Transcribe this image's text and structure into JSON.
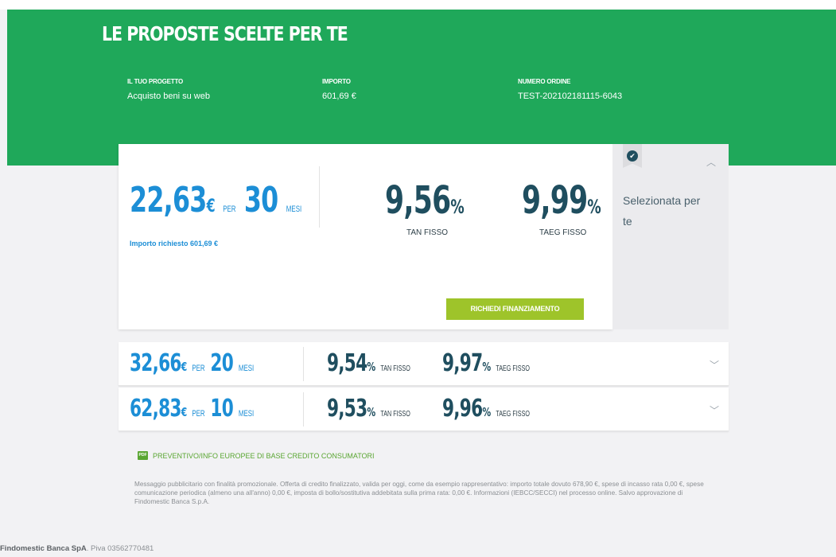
{
  "hero": {
    "title": "LE PROPOSTE SCELTE PER TE",
    "project_label": "IL TUO PROGETTO",
    "project_value": "Acquisto beni su web",
    "amount_label": "IMPORTO",
    "amount_value": "601,69 €",
    "order_label": "NUMERO ORDINE",
    "order_value": "TEST-202102181115-6043"
  },
  "selected_offer": {
    "installment": "22,63",
    "currency": "€",
    "per": "PER",
    "months": "30",
    "months_label": "MESI",
    "requested_amount": "Importo richiesto 601,69 €",
    "tan": "9,56",
    "tan_label": "TAN FISSO",
    "taeg": "9,99",
    "taeg_label": "TAEG FISSO",
    "percent": "%",
    "cta_label": "RICHIEDI FINANZIAMENTO",
    "selected_text": "Selezionata per te",
    "check_icon": "✔",
    "collapse_icon": "︿"
  },
  "alternatives": [
    {
      "installment": "32,66",
      "currency": "€",
      "per": "PER",
      "months": "20",
      "months_label": "MESI",
      "tan": "9,54",
      "tan_label": "TAN FISSO",
      "taeg": "9,97",
      "taeg_label": "TAEG FISSO",
      "percent": "%"
    },
    {
      "installment": "62,83",
      "currency": "€",
      "per": "PER",
      "months": "10",
      "months_label": "MESI",
      "tan": "9,53",
      "tan_label": "TAN FISSO",
      "taeg": "9,96",
      "taeg_label": "TAEG FISSO",
      "percent": "%"
    }
  ],
  "expand_icon": "﹀",
  "pdf": {
    "icon_text": "PDF",
    "label": "PREVENTIVO/INFO EUROPEE DI BASE CREDITO CONSUMATORI"
  },
  "disclaimer": "Messaggio pubblicitario con finalità promozionale. Offerta di credito finalizzato, valida per oggi, come da esempio rappresentativo: importo totale dovuto 678,90 €, spese di incasso rata 0,00 €, spese comunicazione periodica (almeno una all'anno) 0,00 €, imposta di bollo/sostitutiva addebitata sulla prima rata: 0,00 €. Informazioni (IEBCC/SECCI) nel processo online. Salvo approvazione di Findomestic Banca S.p.A.",
  "footer": {
    "company": "Findomestic Banca SpA",
    "vat": ". Piva 03562770481"
  },
  "colors": {
    "green": "#1fa85a",
    "blue": "#1c8ed6",
    "navy": "#1f4e5f",
    "cta": "#9ec42a"
  }
}
